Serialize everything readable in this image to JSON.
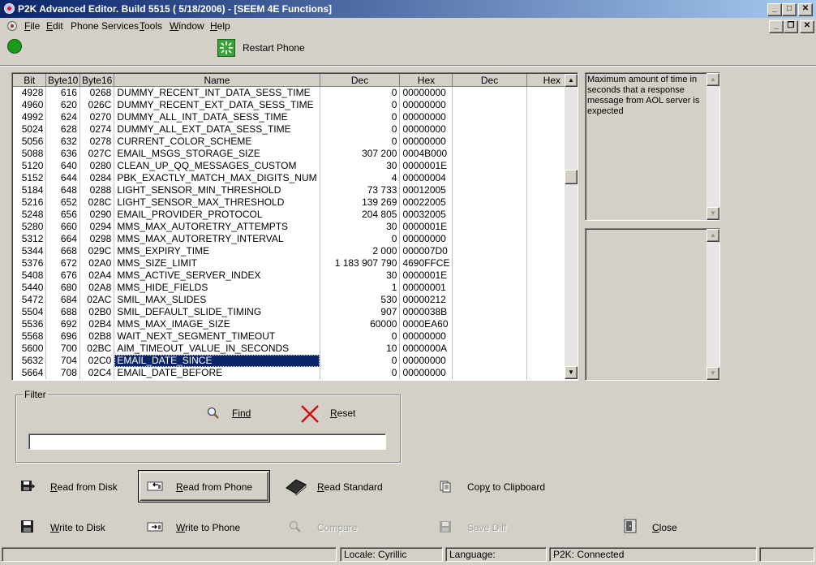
{
  "window": {
    "title": "P2K Advanced Editor. Build 5515 ( 5/18/2006) - [SEEM 4E Functions]"
  },
  "menu": {
    "items": [
      {
        "label": "File",
        "u": "F",
        "rest": "ile"
      },
      {
        "label": "Edit",
        "u": "E",
        "rest": "dit"
      },
      {
        "label": "Phone Services",
        "u": "",
        "rest": "Phone Services"
      },
      {
        "label": "Tools",
        "u": "T",
        "rest": "ools"
      },
      {
        "label": "Window",
        "u": "W",
        "rest": "indow"
      },
      {
        "label": "Help",
        "u": "H",
        "rest": "elp"
      }
    ]
  },
  "toolbar": {
    "restart_label": "Restart Phone",
    "status_color": "#1a9a1a"
  },
  "grid": {
    "headers": [
      "Bit",
      "Byte10",
      "Byte16",
      "Name",
      "Dec",
      "Hex",
      "Dec",
      "Hex"
    ],
    "selected_index": 22,
    "rows": [
      [
        "4928",
        "616",
        "0268",
        "DUMMY_RECENT_INT_DATA_SESS_TIME",
        "0",
        "00000000"
      ],
      [
        "4960",
        "620",
        "026C",
        "DUMMY_RECENT_EXT_DATA_SESS_TIME",
        "0",
        "00000000"
      ],
      [
        "4992",
        "624",
        "0270",
        "DUMMY_ALL_INT_DATA_SESS_TIME",
        "0",
        "00000000"
      ],
      [
        "5024",
        "628",
        "0274",
        "DUMMY_ALL_EXT_DATA_SESS_TIME",
        "0",
        "00000000"
      ],
      [
        "5056",
        "632",
        "0278",
        "CURRENT_COLOR_SCHEME",
        "0",
        "00000000"
      ],
      [
        "5088",
        "636",
        "027C",
        "EMAIL_MSGS_STORAGE_SIZE",
        "307 200",
        "0004B000"
      ],
      [
        "5120",
        "640",
        "0280",
        "CLEAN_UP_QQ_MESSAGES_CUSTOM",
        "30",
        "0000001E"
      ],
      [
        "5152",
        "644",
        "0284",
        "PBK_EXACTLY_MATCH_MAX_DIGITS_NUM",
        "4",
        "00000004"
      ],
      [
        "5184",
        "648",
        "0288",
        "LIGHT_SENSOR_MIN_THRESHOLD",
        "73 733",
        "00012005"
      ],
      [
        "5216",
        "652",
        "028C",
        "LIGHT_SENSOR_MAX_THRESHOLD",
        "139 269",
        "00022005"
      ],
      [
        "5248",
        "656",
        "0290",
        "EMAIL_PROVIDER_PROTOCOL",
        "204 805",
        "00032005"
      ],
      [
        "5280",
        "660",
        "0294",
        "MMS_MAX_AUTORETRY_ATTEMPTS",
        "30",
        "0000001E"
      ],
      [
        "5312",
        "664",
        "0298",
        "MMS_MAX_AUTORETRY_INTERVAL",
        "0",
        "00000000"
      ],
      [
        "5344",
        "668",
        "029C",
        "MMS_EXPIRY_TIME",
        "2 000",
        "000007D0"
      ],
      [
        "5376",
        "672",
        "02A0",
        "MMS_SIZE_LIMIT",
        "1 183 907 790",
        "4690FFCE"
      ],
      [
        "5408",
        "676",
        "02A4",
        "MMS_ACTIVE_SERVER_INDEX",
        "30",
        "0000001E"
      ],
      [
        "5440",
        "680",
        "02A8",
        "MMS_HIDE_FIELDS",
        "1",
        "00000001"
      ],
      [
        "5472",
        "684",
        "02AC",
        "SMIL_MAX_SLIDES",
        "530",
        "00000212"
      ],
      [
        "5504",
        "688",
        "02B0",
        "SMIL_DEFAULT_SLIDE_TIMING",
        "907",
        "0000038B"
      ],
      [
        "5536",
        "692",
        "02B4",
        "MMS_MAX_IMAGE_SIZE",
        "60000",
        "0000EA60"
      ],
      [
        "5568",
        "696",
        "02B8",
        "WAIT_NEXT_SEGMENT_TIMEOUT",
        "0",
        "00000000"
      ],
      [
        "5600",
        "700",
        "02BC",
        "AIM_TIMEOUT_VALUE_IN_SECONDS",
        "10",
        "0000000A"
      ],
      [
        "5632",
        "704",
        "02C0",
        "EMAIL_DATE_SINCE",
        "0",
        "00000000"
      ],
      [
        "5664",
        "708",
        "02C4",
        "EMAIL_DATE_BEFORE",
        "0",
        "00000000"
      ]
    ]
  },
  "description": {
    "text": "Maximum amount of time in seconds that a response message from AOL server is expected"
  },
  "filter": {
    "legend": "Filter",
    "find_label": "Find",
    "reset_label": "Reset",
    "input_value": ""
  },
  "actions": {
    "read_from_disk": "Read from Disk",
    "read_from_phone": "Read from Phone",
    "read_standard": "Read Standard",
    "copy_to_clipboard": "Copy to Clipboard",
    "write_to_disk": "Write to Disk",
    "write_to_phone": "Write to Phone",
    "compare": "Compare",
    "save_diff": "Save Diff",
    "close": "Close"
  },
  "statusbar": {
    "locale": "Locale: Cyrillic",
    "language": "Language:",
    "connection": "P2K: Connected"
  }
}
